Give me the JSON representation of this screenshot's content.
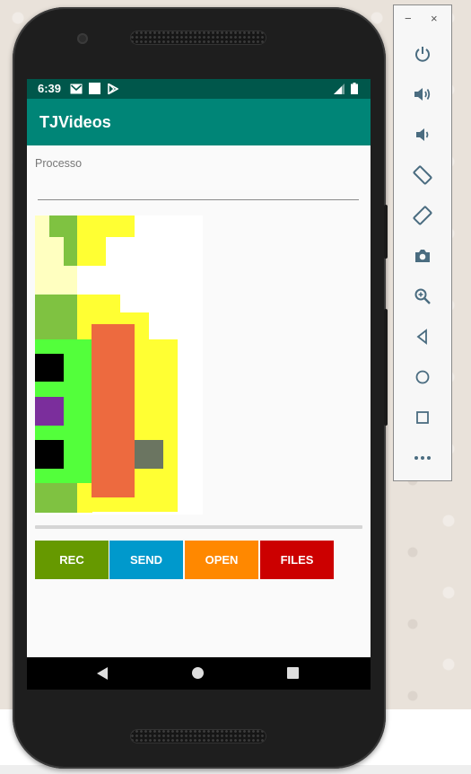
{
  "status_bar": {
    "time": "6:39",
    "icons": [
      "gmail-icon",
      "square-notification-icon",
      "play-store-icon",
      "signal-icon",
      "battery-icon"
    ]
  },
  "app_bar": {
    "title": "TJVideos"
  },
  "form": {
    "label": "Processo",
    "input_value": "",
    "input_placeholder": ""
  },
  "progress": {
    "value": 0
  },
  "buttons": [
    {
      "label": "REC",
      "color": "#669900"
    },
    {
      "label": "SEND",
      "color": "#0099cc"
    },
    {
      "label": "OPEN",
      "color": "#ff8800"
    },
    {
      "label": "FILES",
      "color": "#cc0000"
    }
  ],
  "nav_bar": {
    "icons": [
      "back-icon",
      "home-icon",
      "recents-icon"
    ]
  },
  "emulator_toolbar": {
    "window_controls": [
      "minimize-icon",
      "close-icon"
    ],
    "minimize": "−",
    "close": "×",
    "tools": [
      "power-icon",
      "volume-up-icon",
      "volume-down-icon",
      "rotate-left-icon",
      "rotate-right-icon",
      "camera-icon",
      "zoom-icon",
      "back-icon",
      "home-icon",
      "overview-icon",
      "more-icon"
    ]
  },
  "colors": {
    "status_bar": "#00574b",
    "app_bar": "#008577",
    "preview_green_light": "#7fc241",
    "preview_green": "#53ff3b",
    "preview_yellow": "#ffff33",
    "preview_pale_yellow": "#ffffc0",
    "preview_orange": "#ed6a3f",
    "preview_purple": "#7b2e9c",
    "preview_gray": "#6b7561",
    "preview_black": "#000000"
  }
}
